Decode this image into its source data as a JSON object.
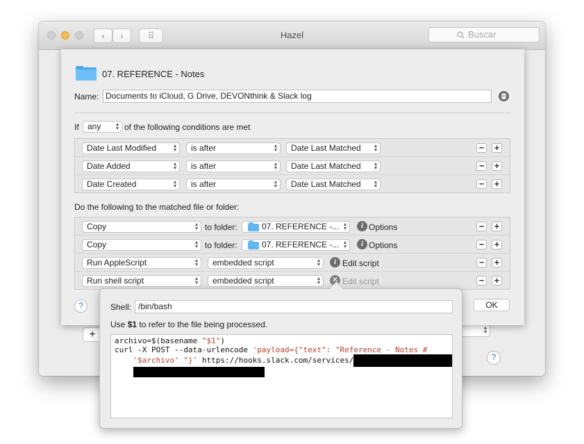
{
  "window": {
    "title": "Hazel",
    "search_placeholder": "Buscar",
    "nav_back": "‹",
    "nav_forward": "›",
    "grid_icon": "⠿"
  },
  "rule": {
    "folder_name": "07. REFERENCE - Notes",
    "name_label": "Name:",
    "name_value": "Documents to iCloud, G Drive, DEVONthink & Slack log",
    "if_label": "If",
    "match_mode": "any",
    "conditions_suffix": "of the following conditions are met",
    "conditions": [
      {
        "attribute": "Date Last Modified",
        "operator": "is after",
        "value": "Date Last Matched"
      },
      {
        "attribute": "Date Added",
        "operator": "is after",
        "value": "Date Last Matched"
      },
      {
        "attribute": "Date Created",
        "operator": "is after",
        "value": "Date Last Matched"
      }
    ],
    "actions_label": "Do the following to the matched file or folder:",
    "actions": [
      {
        "action": "Copy",
        "connector": "to folder:",
        "target": "07. REFERENCE -...",
        "link": "Options"
      },
      {
        "action": "Copy",
        "connector": "to folder:",
        "target": "07. REFERENCE -...",
        "link": "Options"
      },
      {
        "action": "Run AppleScript",
        "target": "embedded script",
        "link": "Edit script"
      },
      {
        "action": "Run shell script",
        "target": "embedded script",
        "link": "Edit script"
      }
    ],
    "ok_label": "OK",
    "help_label": "?"
  },
  "popover": {
    "shell_label": "Shell:",
    "shell_value": "/bin/bash",
    "hint_prefix": "Use",
    "hint_var": "$1",
    "hint_suffix": "to refer to the file being processed.",
    "code": {
      "l1_a": "archivo=$(basename ",
      "l1_b": "\"$1\"",
      "l1_c": ")",
      "l2_a": "curl -X POST --data-urlencode ",
      "l2_b": "'payload={\"text\": \"Reference - Notes #",
      "l3_a": "'$archivo' \"}'",
      "l3_b": " https://hooks.slack.com/services/"
    }
  },
  "background": {
    "plus": "+",
    "help": "?"
  },
  "colors": {
    "accent": "#2e7ae6",
    "folder": "#5fb6f2",
    "string": "#c0392b"
  }
}
